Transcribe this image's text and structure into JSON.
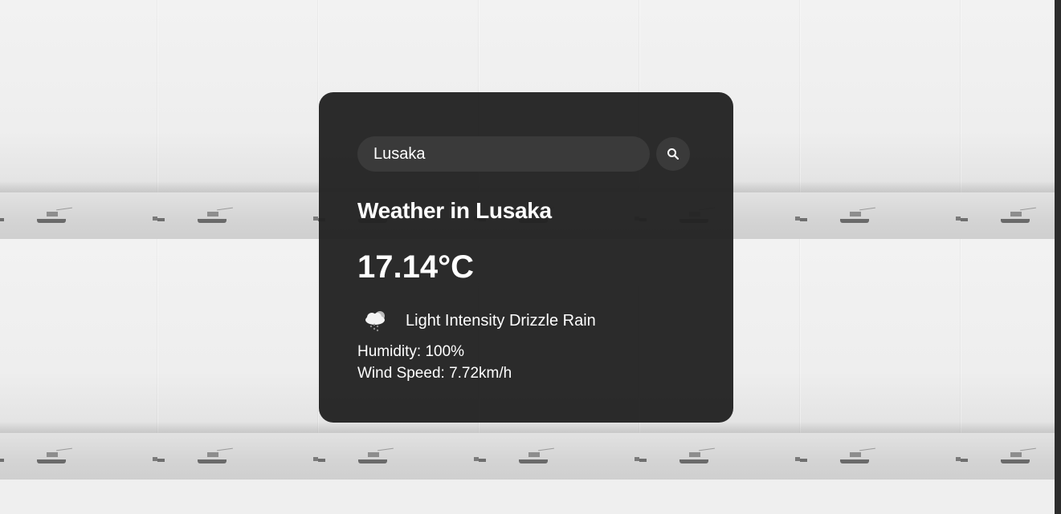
{
  "search": {
    "value": "Lusaka",
    "button_icon": "search-icon"
  },
  "weather": {
    "title": "Weather in Lusaka",
    "temperature": "17.14°C",
    "icon": "cloud-drizzle-icon",
    "description": "Light Intensity Drizzle Rain",
    "humidity": "Humidity: 100%",
    "wind": "Wind Speed: 7.72km/h"
  },
  "colors": {
    "card_background": "#222222",
    "input_background": "#3a3a3a",
    "text": "#ffffff",
    "page_background": "#efefef"
  }
}
